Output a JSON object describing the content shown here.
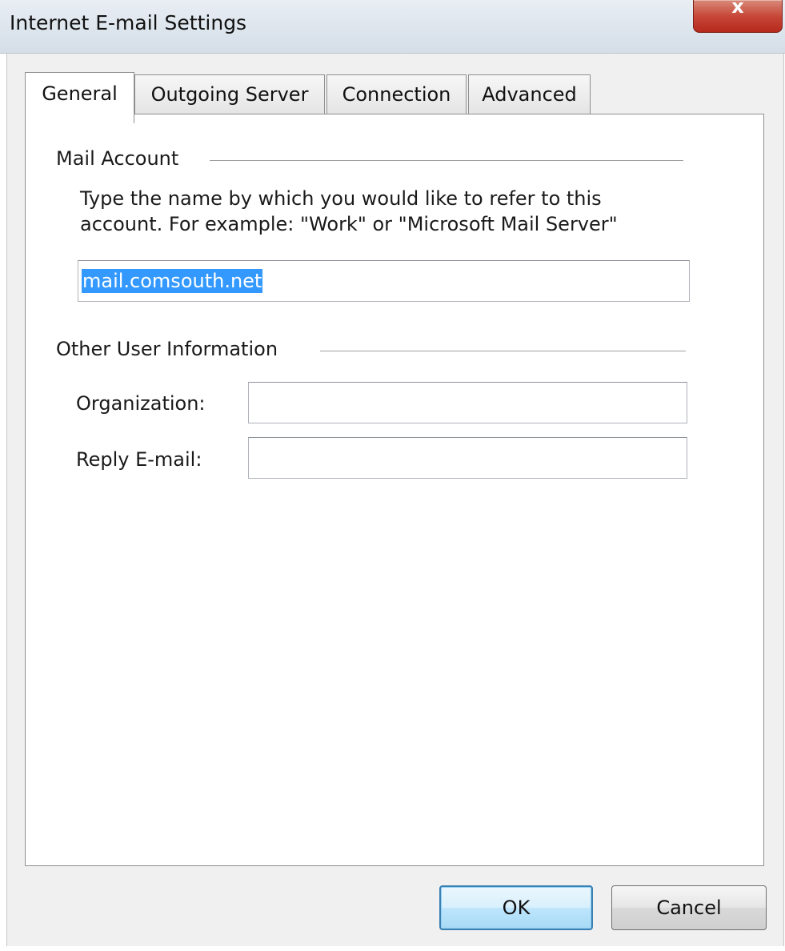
{
  "window": {
    "title": "Internet E-mail Settings",
    "close_icon": "close-icon"
  },
  "tabs": [
    {
      "label": "General",
      "active": true
    },
    {
      "label": "Outgoing Server",
      "active": false
    },
    {
      "label": "Connection",
      "active": false
    },
    {
      "label": "Advanced",
      "active": false
    }
  ],
  "mail_account": {
    "group_label": "Mail Account",
    "description": "Type the name by which you would like to refer to this account.  For example: \"Work\" or \"Microsoft Mail Server\"",
    "account_name_value": "mail.comsouth.net"
  },
  "other_user_info": {
    "group_label": "Other User Information",
    "organization_label": "Organization:",
    "organization_value": "",
    "reply_email_label": "Reply E-mail:",
    "reply_email_value": ""
  },
  "buttons": {
    "ok_label": "OK",
    "cancel_label": "Cancel"
  },
  "colors": {
    "selection": "#3399ff",
    "close_button": "#c7483a",
    "default_button_border": "#3c7fb1"
  }
}
